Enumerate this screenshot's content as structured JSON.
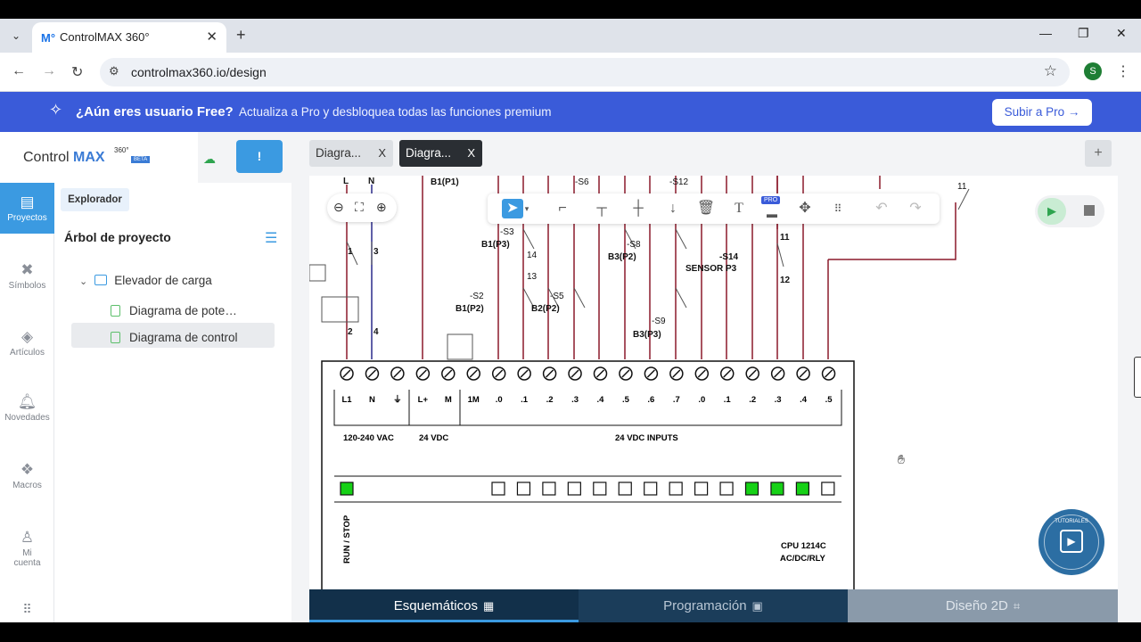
{
  "browser": {
    "tab_title": "ControlMAX 360°",
    "favicon": "M°",
    "url": "controlmax360.io/design",
    "profile_initial": "S"
  },
  "promo": {
    "question": "¿Aún eres usuario Free?",
    "message": "Actualiza a Pro y desbloquea todas las funciones premium",
    "button": "Subir a Pro →"
  },
  "brand": {
    "name_a": "Control",
    "name_b": "MAX",
    "sup": "360°",
    "beta": "BETA"
  },
  "rail": {
    "items": [
      {
        "label": "Proyectos",
        "icon": "folder-icon"
      },
      {
        "label": "Símbolos",
        "icon": "symbols-icon"
      },
      {
        "label": "Artículos",
        "icon": "box-icon"
      },
      {
        "label": "Novedades",
        "icon": "bell-icon"
      },
      {
        "label": "Macros",
        "icon": "macro-icon"
      },
      {
        "label": "Mi",
        "label2": "cuenta",
        "icon": "user-icon"
      }
    ]
  },
  "panel": {
    "explorer": "Explorador",
    "tree_title": "Árbol de proyecto",
    "project": "Elevador de carga",
    "docs": [
      "Diagrama de pote…",
      "Diagrama de control"
    ]
  },
  "doc_tabs": [
    {
      "label": "Diagra...",
      "close": "X"
    },
    {
      "label": "Diagra...",
      "close": "X"
    }
  ],
  "plus": "+",
  "toolbar": {
    "pro": "PRO"
  },
  "diagram": {
    "labels_top": [
      "B1(P1)",
      "-S6",
      "-S12",
      "11"
    ],
    "contacts": [
      {
        "tag": "-S3",
        "name": "B1(P3)"
      },
      {
        "tag": "-S8",
        "name": "B3(P2)"
      },
      {
        "tag": "-S14",
        "name": "SENSOR P3"
      },
      {
        "tag": "-S2",
        "name": "B1(P2)"
      },
      {
        "tag": "-S5",
        "name": "B2(P2)"
      },
      {
        "tag": "-S9",
        "name": "B3(P3)"
      }
    ],
    "pins": [
      "1",
      "3",
      "2",
      "4",
      "L",
      "N",
      "14",
      "13",
      "11",
      "12"
    ],
    "plc_terms": [
      "L1",
      "N",
      "⏚",
      "L+",
      "M",
      "1M",
      ".0",
      ".1",
      ".2",
      ".3",
      ".4",
      ".5",
      ".6",
      ".7",
      ".0",
      ".1",
      ".2",
      ".3",
      ".4",
      ".5"
    ],
    "plc_power": "120-240 VAC",
    "plc_dc": "24 VDC",
    "plc_inputs": "24 VDC INPUTS",
    "run_stop": "RUN / STOP",
    "cpu": "CPU 1214C",
    "cpu_type": "AC/DC/RLY",
    "leds_on": [
      0,
      11,
      12,
      13
    ]
  },
  "badge": {
    "text": "TUTORIALES"
  },
  "bottom_tabs": [
    "Esquemáticos",
    "Programación",
    "Diseño 2D"
  ]
}
